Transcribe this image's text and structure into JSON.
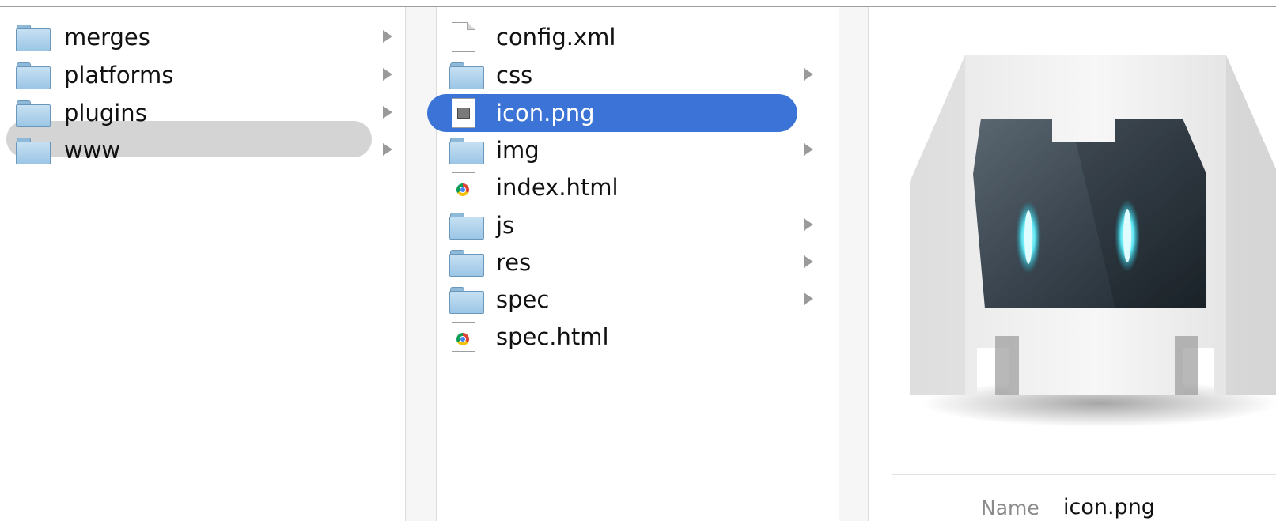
{
  "column1": {
    "items": [
      {
        "label": "merges",
        "type": "folder",
        "selected": false
      },
      {
        "label": "platforms",
        "type": "folder",
        "selected": false
      },
      {
        "label": "plugins",
        "type": "folder",
        "selected": false
      },
      {
        "label": "www",
        "type": "folder",
        "selected": true
      }
    ]
  },
  "column2": {
    "items": [
      {
        "label": "config.xml",
        "type": "file-generic",
        "selected": false
      },
      {
        "label": "css",
        "type": "folder",
        "selected": false
      },
      {
        "label": "icon.png",
        "type": "file-image",
        "selected": true
      },
      {
        "label": "img",
        "type": "folder",
        "selected": false
      },
      {
        "label": "index.html",
        "type": "file-html",
        "selected": false
      },
      {
        "label": "js",
        "type": "folder",
        "selected": false
      },
      {
        "label": "res",
        "type": "folder",
        "selected": false
      },
      {
        "label": "spec",
        "type": "folder",
        "selected": false
      },
      {
        "label": "spec.html",
        "type": "file-html",
        "selected": false
      }
    ]
  },
  "preview": {
    "image_icon": "cordova-robot-icon",
    "name_label": "Name",
    "name_value": "icon.png"
  },
  "colors": {
    "selection_active": "#3b74d6",
    "selection_inactive": "#d4d4d4",
    "folder_blue": "#9cc6e6"
  }
}
